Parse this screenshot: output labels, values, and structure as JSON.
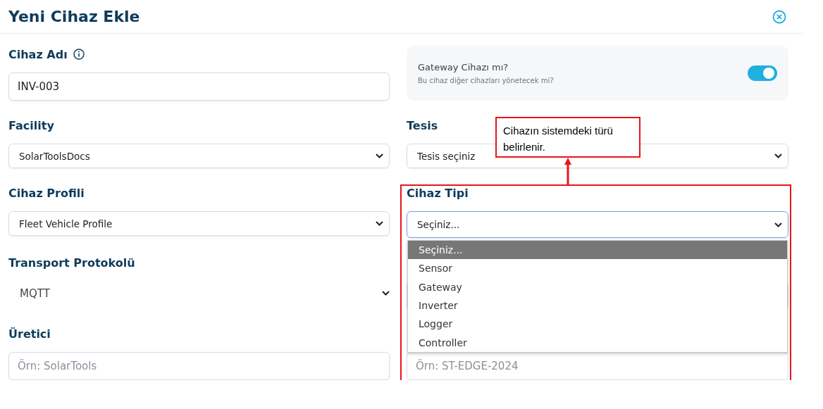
{
  "dialog": {
    "title": "Yeni Cihaz Ekle"
  },
  "rows": [
    {
      "left": {
        "kind": "text",
        "label": "Cihaz Adı",
        "info": true,
        "value": "INV-003"
      },
      "right": {
        "kind": "toggle-card",
        "title": "Gateway Cihazı mı?",
        "hint": "Bu cihaz diğer cihazları yönetecek mi?",
        "on": true
      }
    },
    {
      "left": {
        "kind": "select",
        "label": "Facility",
        "value": "SolarToolsDocs"
      },
      "right": {
        "kind": "select",
        "label": "Tesis",
        "value": "Tesis seçiniz"
      }
    },
    {
      "left": {
        "kind": "select",
        "label": "Cihaz Profili",
        "value": "Fleet Vehicle Profile"
      },
      "right": {
        "kind": "select",
        "label": "Cihaz Tipi",
        "value": "Seçiniz...",
        "focused": true,
        "expanded": true,
        "options": [
          {
            "label": "Seçiniz...",
            "selected": true
          },
          {
            "label": "Sensor",
            "selected": false
          },
          {
            "label": "Gateway",
            "selected": false
          },
          {
            "label": "Inverter",
            "selected": false
          },
          {
            "label": "Logger",
            "selected": false
          },
          {
            "label": "Controller",
            "selected": false
          }
        ]
      }
    },
    {
      "left": {
        "kind": "plain-select",
        "label": "Transport Protokolü",
        "value": "MQTT"
      },
      "right": {
        "kind": "hidden"
      }
    },
    {
      "left": {
        "kind": "text",
        "label": "Üretici",
        "placeholder": "Örn: SolarTools"
      },
      "right": {
        "kind": "text",
        "placeholder": "Örn: ST-EDGE-2024"
      }
    }
  ],
  "annotation": {
    "text": "Cihazın sistemdeki türü belirlenir."
  }
}
